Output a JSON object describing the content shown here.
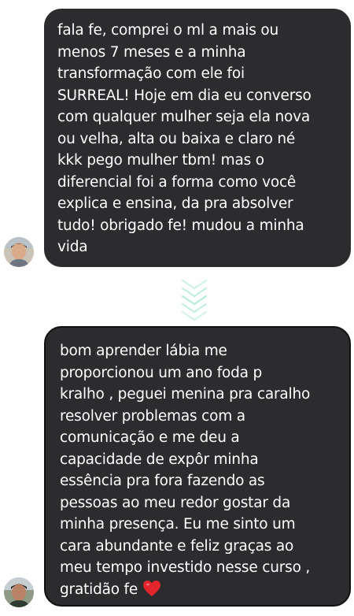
{
  "messages": [
    {
      "text": "fala fe, comprei o ml a mais ou\nmenos 7 meses e a minha\ntransformação com ele foi\nSURREAL! Hoje em dia eu converso\ncom qualquer mulher seja ela nova\nou velha, alta ou baixa e claro né\nkkk pego mulher tbm! mas o\ndiferencial foi a forma como você\nexplica e ensina, da pra absolver\ntudo! obrigado fe! mudou a minha\nvida"
    },
    {
      "text": "bom aprender lábia me\nproporcionou um ano foda p\nkralho , peguei menina pra caralho\nresolver problemas com a\ncomunicação e me deu a\ncapacidade de expôr minha\nessência pra fora fazendo as\npessoas ao meu redor gostar da\nminha presença. Eu me sinto um\ncara abundante e feliz graças ao\nmeu tempo investido nesse curso ,\ngratidão fe",
      "emoji": "heart-icon"
    }
  ],
  "colors": {
    "bubble": "#2c2c2e",
    "text": "#ffffff",
    "chevron": "#a6e6d5",
    "heart": "#e2242c"
  }
}
